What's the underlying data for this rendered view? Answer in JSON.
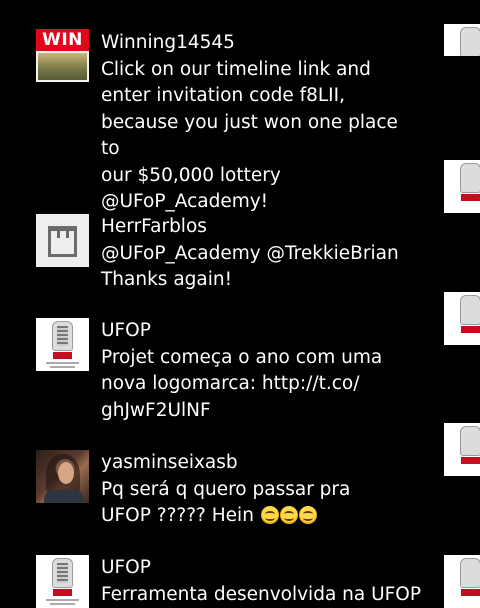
{
  "tweets": [
    {
      "author": "Winning14545",
      "text": "Click on our timeline link and\nenter invitation code f8LII,\nbecause you just won one place to\nour $50,000 lottery\n@UFoP_Academy!",
      "avatar_label": "WIN",
      "avatar": "win-money-avatar"
    },
    {
      "author": "HerrFarblos",
      "text": "@UFoP_Academy @TrekkieBrian\nThanks again!",
      "avatar": "square-logo-avatar"
    },
    {
      "author": "UFOP",
      "text": "Projet começa o ano com uma\nnova logomarca: http://t.co/\nghJwF2UlNF",
      "avatar": "ufop-emblem-avatar"
    },
    {
      "author": "yasminseixasb",
      "text": "Pq será q quero passar pra\nUFOP ????? Hein ",
      "emoji": [
        "grinning-face",
        "grinning-face",
        "grinning-face"
      ],
      "avatar": "user-photo-avatar"
    },
    {
      "author": "UFOP",
      "text": "Ferramenta desenvolvida na UFOP",
      "avatar": "ufop-emblem-avatar"
    }
  ],
  "colors": {
    "background": "#000000",
    "text": "#ffffff",
    "win_red": "#e2061c",
    "ufop_red": "#c40d1e"
  }
}
